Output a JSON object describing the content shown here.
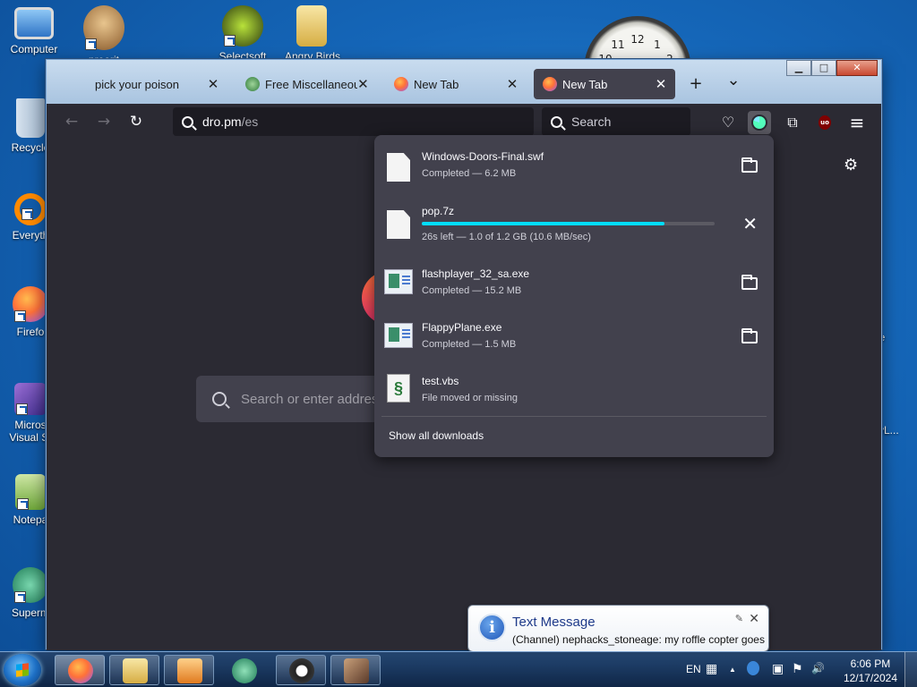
{
  "desktop": {
    "icons": [
      {
        "label": "Computer"
      },
      {
        "label": "Recycle"
      },
      {
        "label": "Everyth"
      },
      {
        "label": "Firefo"
      },
      {
        "label": "Micros Visual St"
      },
      {
        "label": "Notepa"
      },
      {
        "label": "Superm"
      },
      {
        "label": "preorit"
      },
      {
        "label": "Selectsoft"
      },
      {
        "label": "Angry Birds"
      }
    ],
    "right_labels": {
      "plane": "ne",
      "other": "cyL..."
    }
  },
  "browser": {
    "tabs": [
      {
        "title": "pick your poison",
        "close": "✕"
      },
      {
        "title": "Free Miscellaneous S",
        "close": "✕"
      },
      {
        "title": "New Tab",
        "close": "✕"
      },
      {
        "title": "New Tab",
        "close": "✕"
      }
    ],
    "new_tab_symbol": "+",
    "list_tabs_symbol": "⌄",
    "window_buttons": {
      "minimize": "▁",
      "maximize": "□",
      "close": "✕"
    },
    "nav": {
      "back": "←",
      "forward": "→",
      "reload": "↻"
    },
    "url": {
      "host": "dro.pm",
      "path": "/es"
    },
    "search": {
      "placeholder": "Search"
    },
    "toolbar_icons": {
      "pocket": "♡",
      "extensions": "⧉",
      "ublock": "uo",
      "menu": "≡"
    },
    "page": {
      "settings_symbol": "⚙",
      "search_placeholder": "Search or enter addres"
    }
  },
  "downloads": {
    "items": [
      {
        "name": "Windows-Doors-Final.swf",
        "status": "Completed — 6.2 MB",
        "type": "file",
        "action": "folder-icon"
      },
      {
        "name": "pop.7z",
        "status": "26s left — 1.0 of 1.2 GB (10.6 MB/sec)",
        "type": "file",
        "action": "cancel-icon",
        "progress": 0.83
      },
      {
        "name": "flashplayer_32_sa.exe",
        "status": "Completed — 15.2 MB",
        "type": "exe",
        "action": "folder-icon"
      },
      {
        "name": "FlappyPlane.exe",
        "status": "Completed — 1.5 MB",
        "type": "exe",
        "action": "folder-icon"
      },
      {
        "name": "test.vbs",
        "status": "File moved or missing",
        "type": "vbs",
        "action": "none"
      }
    ],
    "cancel_symbol": "✕",
    "show_all": "Show all downloads"
  },
  "notification": {
    "title": "Text Message",
    "message": "(Channel) nephacks_stoneage: my roffle copter goes",
    "icon_letter": "i",
    "pin_symbol": "✎",
    "close_symbol": "✕"
  },
  "taskbar": {
    "language": "EN",
    "time": "6:06 PM",
    "date": "12/17/2024",
    "tray_symbols": {
      "keyboard": "▦",
      "up": "▲",
      "network": "▣",
      "flag": "⚑",
      "volume": "🔊"
    }
  },
  "colors": {
    "accent_progress": "#00ddff",
    "panel_bg": "#42414d",
    "toolbar_bg": "#2b2a33"
  }
}
